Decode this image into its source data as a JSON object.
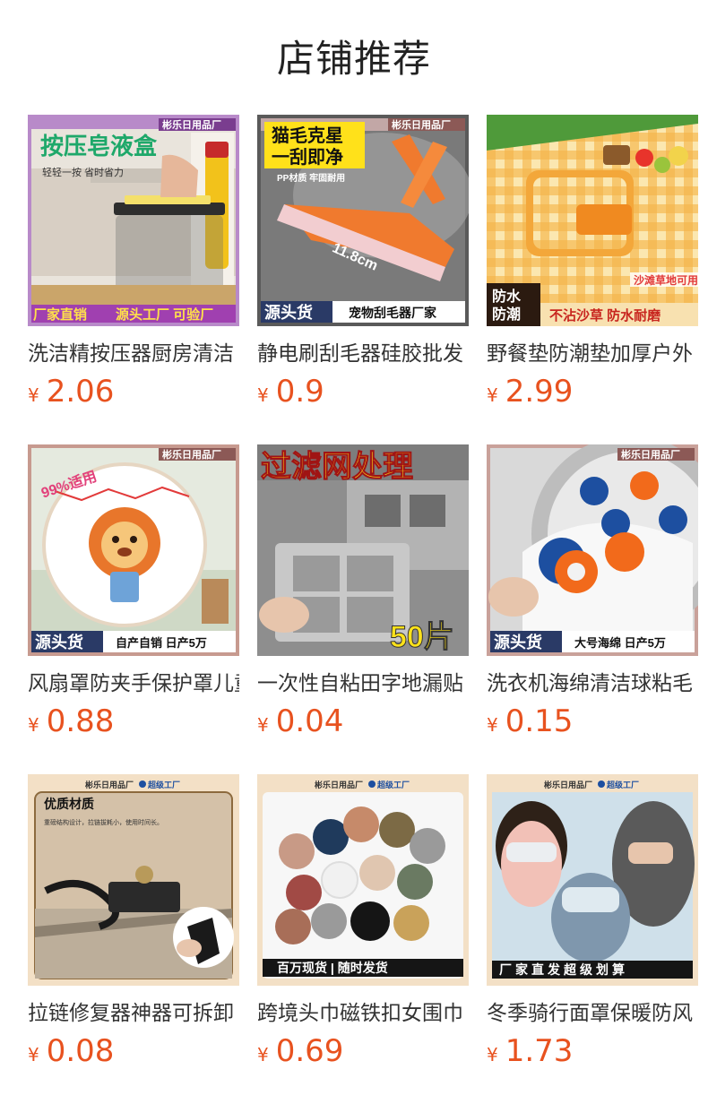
{
  "page": {
    "title": "店铺推荐"
  },
  "products": [
    {
      "name": "洗洁精按压器厨房清洁",
      "currency": "¥",
      "price": "2.06",
      "image": {
        "shop": "彬乐日用品厂",
        "headline": "按压皂液盒",
        "sub": "轻轻一按 省时省力",
        "footer_left": "厂家直销",
        "footer_right": "源头工厂 可验厂"
      }
    },
    {
      "name": "静电刷刮毛器硅胶批发",
      "currency": "¥",
      "price": "0.9",
      "image": {
        "shop": "彬乐日用品厂",
        "headline_1": "猫毛克星",
        "headline_2": "一刮即净",
        "sub": "PP材质 牢固耐用",
        "measure": "11.8cm",
        "footer_left": "源头货",
        "footer_right": "宠物刮毛器厂家"
      }
    },
    {
      "name": "野餐垫防潮垫加厚户外",
      "currency": "¥",
      "price": "2.99",
      "image": {
        "badge_1": "防水",
        "badge_2": "防潮",
        "tag": "沙滩草地可用",
        "footer": "不沾沙草 防水耐磨"
      }
    },
    {
      "name": "风扇罩防夹手保护罩儿童",
      "currency": "¥",
      "price": "0.88",
      "image": {
        "shop": "彬乐日用品厂",
        "badge": "99%适用",
        "footer_left": "源头货",
        "footer_right": "自产自销 日产5万"
      }
    },
    {
      "name": "一次性自粘田字地漏贴",
      "currency": "¥",
      "price": "0.04",
      "image": {
        "headline": "过滤网处理",
        "count": "50片"
      }
    },
    {
      "name": "洗衣机海绵清洁球粘毛",
      "currency": "¥",
      "price": "0.15",
      "image": {
        "shop": "彬乐日用品厂",
        "footer_left": "源头货",
        "footer_right": "大号海绵 日产5万"
      }
    },
    {
      "name": "拉链修复器神器可拆卸",
      "currency": "¥",
      "price": "0.08",
      "image": {
        "shop": "彬乐日用品厂",
        "tier": "超级工厂",
        "headline": "优质材质",
        "sub": "重磅结构设计，拉链拔耗小，使用时间长。"
      }
    },
    {
      "name": "跨境头巾磁铁扣女围巾",
      "currency": "¥",
      "price": "0.69",
      "image": {
        "shop": "彬乐日用品厂",
        "tier": "超级工厂",
        "footer": "百万现货 | 随时发货"
      }
    },
    {
      "name": "冬季骑行面罩保暖防风",
      "currency": "¥",
      "price": "1.73",
      "image": {
        "shop": "彬乐日用品厂",
        "tier": "超级工厂",
        "footer": "厂家直发超级划算"
      }
    }
  ],
  "colors": {
    "price": "#e8521f",
    "title": "#222222",
    "name": "#333333"
  }
}
